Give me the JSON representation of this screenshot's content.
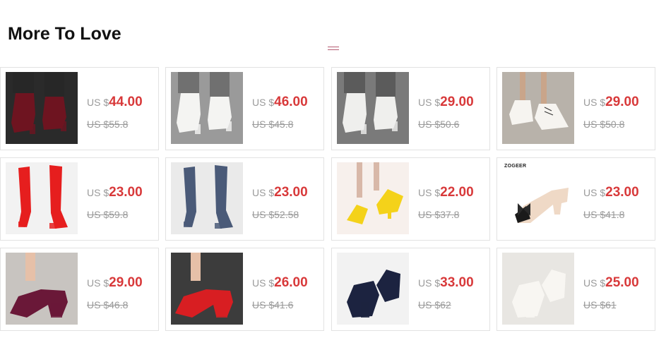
{
  "section": {
    "title": "More To Love",
    "menu_icon": "hamburger-icon",
    "price_color": "#d8393a",
    "muted_color": "#9a9a9a"
  },
  "products": [
    {
      "currency": "US $",
      "price": "44.00",
      "original_price": "US $55.8",
      "bg": "#2a2a2a",
      "shoe": "#6e1420",
      "style": "ankle-boot"
    },
    {
      "currency": "US $",
      "price": "46.00",
      "original_price": "US $45.8",
      "bg": "#9a9a9a",
      "shoe": "#f4f4f2",
      "style": "ankle-boot"
    },
    {
      "currency": "US $",
      "price": "29.00",
      "original_price": "US $50.6",
      "bg": "#7a7a7a",
      "shoe": "#efefed",
      "style": "ankle-boot"
    },
    {
      "currency": "US $",
      "price": "29.00",
      "original_price": "US $50.8",
      "bg": "#b8b2aa",
      "shoe": "#f6f4f0",
      "style": "lace-boot"
    },
    {
      "currency": "US $",
      "price": "23.00",
      "original_price": "US $59.8",
      "bg": "#f2f2f2",
      "shoe": "#e61e1e",
      "style": "tall-boot"
    },
    {
      "currency": "US $",
      "price": "23.00",
      "original_price": "US $52.58",
      "bg": "#eaeaea",
      "shoe": "#4a5a78",
      "style": "tall-boot"
    },
    {
      "currency": "US $",
      "price": "22.00",
      "original_price": "US $37.8",
      "bg": "#f7f0ec",
      "shoe": "#f4d21a",
      "style": "mary-jane"
    },
    {
      "currency": "US $",
      "price": "23.00",
      "original_price": "US $41.8",
      "bg": "#ffffff",
      "shoe": "#efd9c6",
      "style": "bow-pump",
      "brand": "ZOGEER"
    },
    {
      "currency": "US $",
      "price": "29.00",
      "original_price": "US $46.8",
      "bg": "#c8c4c0",
      "shoe": "#6a1838",
      "style": "pump"
    },
    {
      "currency": "US $",
      "price": "26.00",
      "original_price": "US $41.6",
      "bg": "#3c3c3c",
      "shoe": "#d81e22",
      "style": "pump"
    },
    {
      "currency": "US $",
      "price": "33.00",
      "original_price": "US $62",
      "bg": "#f2f2f2",
      "shoe": "#1c2340",
      "style": "platform"
    },
    {
      "currency": "US $",
      "price": "25.00",
      "original_price": "US $61",
      "bg": "#e8e6e2",
      "shoe": "#f8f6f2",
      "style": "platform"
    }
  ]
}
